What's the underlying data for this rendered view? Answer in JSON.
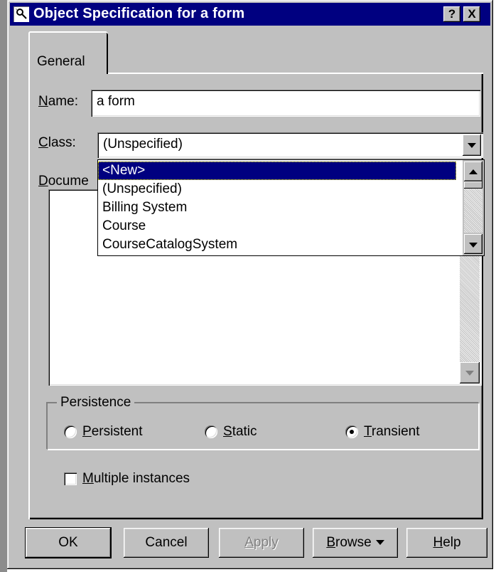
{
  "window": {
    "title": "Object Specification for a form",
    "help_glyph": "?",
    "close_glyph": "X"
  },
  "tabs": [
    {
      "label": "General"
    }
  ],
  "name_field": {
    "label_mnemonic": "N",
    "label_rest": "ame:",
    "value": "a form"
  },
  "class_field": {
    "label_mnemonic": "C",
    "label_rest": "lass:",
    "value": "(Unspecified)",
    "options": [
      "<New>",
      "(Unspecified)",
      "Billing System",
      "Course",
      "CourseCatalogSystem"
    ],
    "selected_option": "<New>"
  },
  "documentation": {
    "label_mnemonic": "D",
    "label_rest": "ocume"
  },
  "persistence": {
    "title": "Persistence",
    "options": [
      {
        "mnemonic": "P",
        "rest": "ersistent",
        "checked": false
      },
      {
        "mnemonic": "S",
        "rest": "tatic",
        "checked": false
      },
      {
        "mnemonic": "T",
        "rest": "ransient",
        "checked": true
      }
    ]
  },
  "multiple_instances": {
    "mnemonic": "M",
    "rest": "ultiple instances",
    "checked": false
  },
  "buttons": {
    "ok": "OK",
    "cancel": "Cancel",
    "apply_mnemonic": "A",
    "apply_rest": "pply",
    "browse_mnemonic": "B",
    "browse_rest": "rowse",
    "help_mnemonic": "H",
    "help_rest": "elp"
  },
  "colors": {
    "titlebar": "#000080",
    "face": "#c0c0c0",
    "selection": "#000080"
  }
}
